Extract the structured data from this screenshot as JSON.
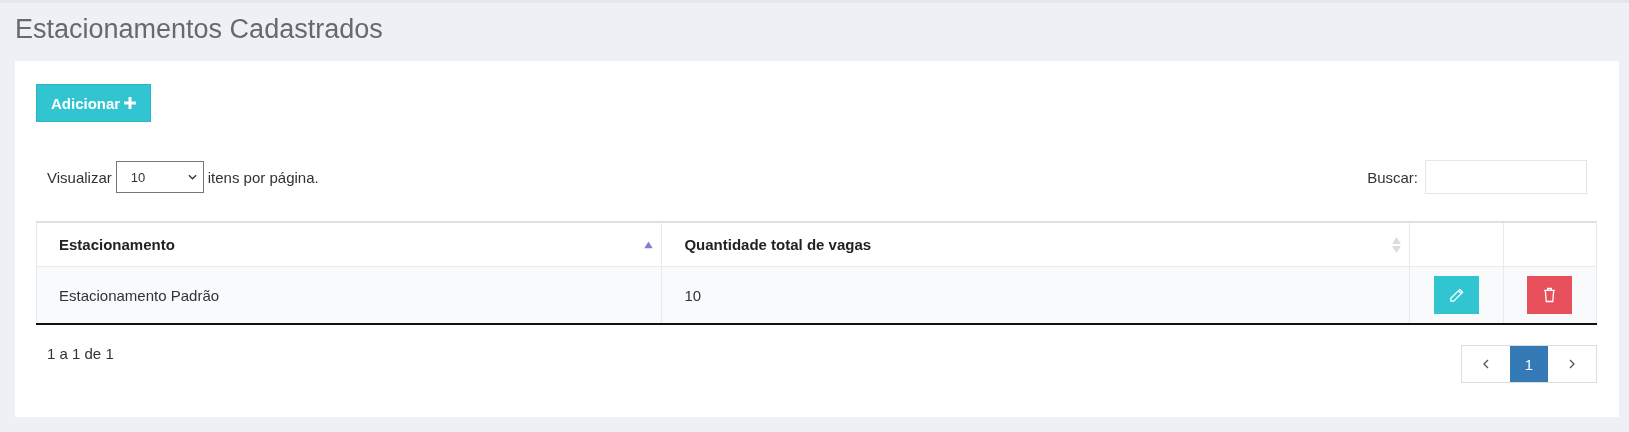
{
  "page_title": "Estacionamentos Cadastrados",
  "add_button": {
    "label": "Adicionar"
  },
  "page_size": {
    "prefix": "Visualizar",
    "value": "10",
    "suffix": "itens por página."
  },
  "search": {
    "label": "Buscar:"
  },
  "table": {
    "columns": [
      {
        "kind": "data",
        "label": "Estacionamento",
        "sorted": true
      },
      {
        "kind": "data",
        "label": "Quantidade total de vagas",
        "sorted": false
      },
      {
        "kind": "action"
      },
      {
        "kind": "action"
      }
    ],
    "rows": [
      {
        "cells": [
          "Estacionamento Padrão",
          "10"
        ]
      }
    ]
  },
  "info": "1 a 1 de 1",
  "pagination": {
    "pages": [
      {
        "label": "1",
        "selected": true
      }
    ]
  }
}
